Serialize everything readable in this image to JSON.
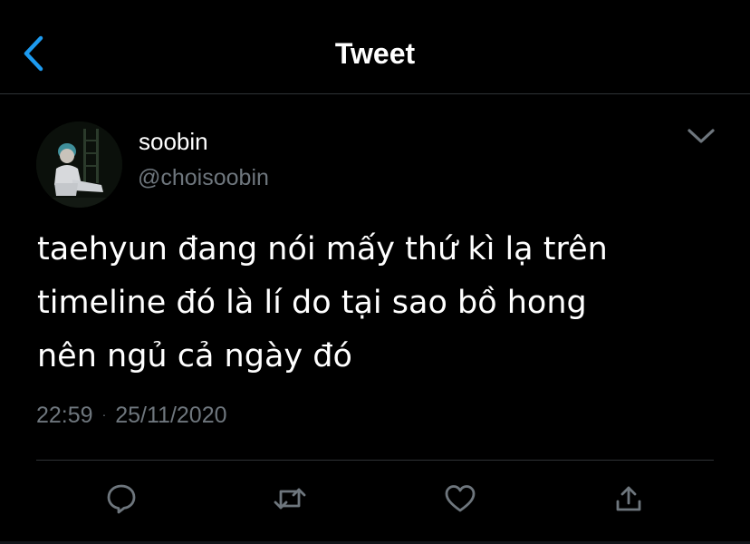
{
  "header": {
    "title": "Tweet",
    "back_icon": "chevron-left-icon"
  },
  "colors": {
    "background": "#000000",
    "accent": "#1d9bf0",
    "muted_text": "#6e767d",
    "divider": "#2f3336"
  },
  "author": {
    "display_name": "soobin",
    "handle": "@choisoobin",
    "avatar_icon": "profile-photo"
  },
  "tweet": {
    "lines": [
      "taehyun đang nói mấy thứ kì lạ trên",
      "timeline đó là lí do tại sao bồ hong",
      "nên ngủ cả ngày đó"
    ],
    "time": "22:59",
    "separator": "·",
    "date": "25/11/2020"
  },
  "actions": [
    {
      "name": "reply",
      "icon": "reply-icon"
    },
    {
      "name": "retweet",
      "icon": "retweet-icon"
    },
    {
      "name": "like",
      "icon": "heart-icon"
    },
    {
      "name": "share",
      "icon": "share-icon"
    }
  ]
}
